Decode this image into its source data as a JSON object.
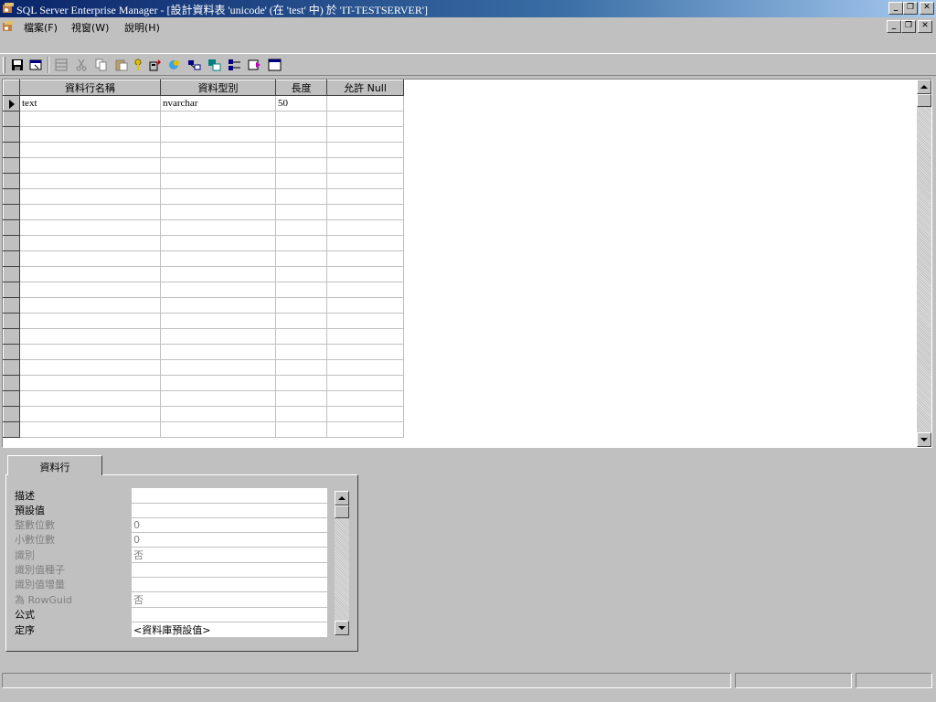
{
  "window": {
    "title": "SQL Server Enterprise Manager - [設計資料表 'unicode' (在 'test' 中) 於 'IT-TESTSERVER']",
    "controls": [
      "minimize-icon",
      "restore-icon",
      "close-icon"
    ]
  },
  "menubar": {
    "items": [
      "檔案(F)",
      "視窗(W)",
      "說明(H)"
    ]
  },
  "toolbar": {
    "buttons": [
      "save-icon",
      "properties-icon",
      "insert-column-icon",
      "cut-icon",
      "copy-icon",
      "paste-icon",
      "primary-key-icon",
      "manage-triggers-icon",
      "manage-permissions-icon",
      "manage-relationships-icon",
      "manage-indexes-icon",
      "manage-constraints-icon",
      "generate-script-icon",
      "design-view-icon"
    ]
  },
  "grid": {
    "columns": [
      "資料行名稱",
      "資料型別",
      "長度",
      "允許 Null"
    ],
    "rows": [
      [
        "text",
        "nvarchar",
        "50",
        ""
      ]
    ],
    "empty_rows": 21
  },
  "properties": {
    "tab_label": "資料行",
    "items": [
      {
        "label": "描述",
        "value": "",
        "enabled": true
      },
      {
        "label": "預設值",
        "value": "",
        "enabled": true
      },
      {
        "label": "整數位數",
        "value": "0",
        "enabled": false
      },
      {
        "label": "小數位數",
        "value": "0",
        "enabled": false
      },
      {
        "label": "識別",
        "value": "否",
        "enabled": false
      },
      {
        "label": "識別值種子",
        "value": "",
        "enabled": false
      },
      {
        "label": "識別值增量",
        "value": "",
        "enabled": false
      },
      {
        "label": "為 RowGuid",
        "value": "否",
        "enabled": false
      },
      {
        "label": "公式",
        "value": "",
        "enabled": true
      },
      {
        "label": "定序",
        "value": "<資料庫預設值>",
        "enabled": true
      }
    ]
  }
}
